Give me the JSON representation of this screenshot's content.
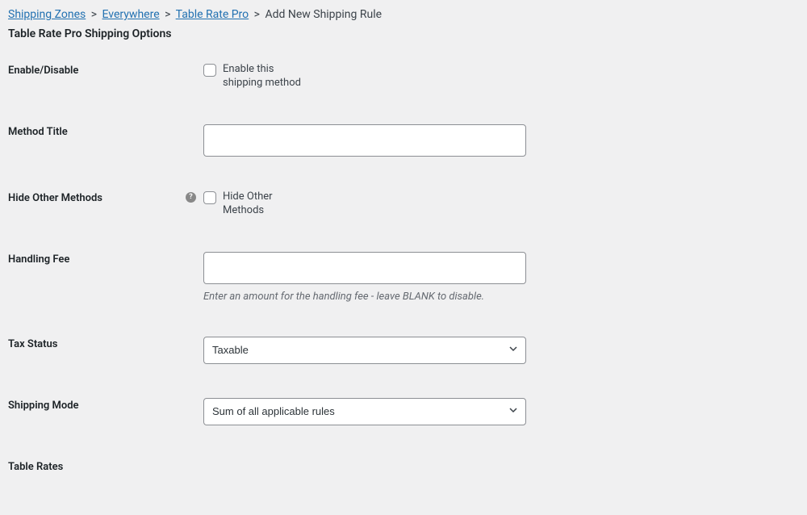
{
  "breadcrumb": {
    "links": [
      "Shipping Zones",
      "Everywhere",
      "Table Rate Pro"
    ],
    "current": "Add New Shipping Rule"
  },
  "page_title": "Table Rate Pro Shipping Options",
  "fields": {
    "enable": {
      "label": "Enable/Disable",
      "checkbox_label": "Enable this shipping method"
    },
    "method_title": {
      "label": "Method Title",
      "value": ""
    },
    "hide_others": {
      "label": "Hide Other Methods",
      "checkbox_label": "Hide Other Methods"
    },
    "handling_fee": {
      "label": "Handling Fee",
      "value": "",
      "description": "Enter an amount for the handling fee - leave BLANK to disable."
    },
    "tax_status": {
      "label": "Tax Status",
      "selected": "Taxable"
    },
    "shipping_mode": {
      "label": "Shipping Mode",
      "selected": "Sum of all applicable rules"
    },
    "table_rates": {
      "label": "Table Rates"
    }
  }
}
